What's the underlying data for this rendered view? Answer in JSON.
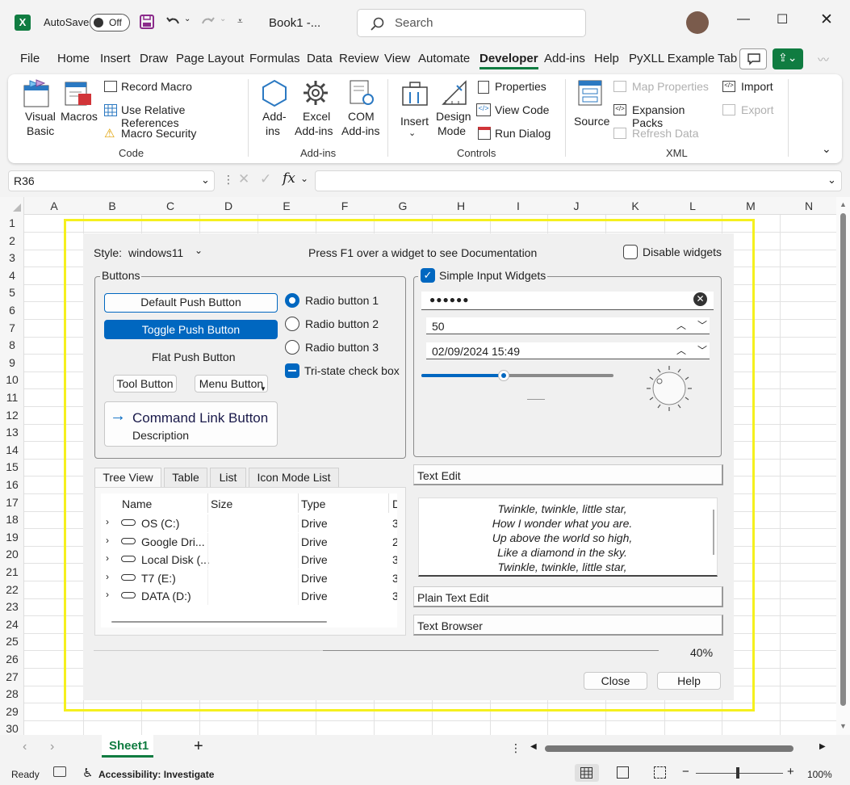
{
  "titlebar": {
    "autosave_label": "AutoSave",
    "autosave_state": "Off",
    "book_title": "Book1  -...",
    "search_placeholder": "Search"
  },
  "menu": [
    "File",
    "Home",
    "Insert",
    "Draw",
    "Page Layout",
    "Formulas",
    "Data",
    "Review",
    "View",
    "Automate",
    "Developer",
    "Add-ins",
    "Help",
    "PyXLL Example Tab"
  ],
  "menu_selected": "Developer",
  "ribbon": {
    "visual_basic": [
      "Visual",
      "Basic"
    ],
    "macros": "Macros",
    "record_macro": "Record Macro",
    "use_relative": "Use Relative References",
    "macro_security": "Macro Security",
    "code_group": "Code",
    "addins": [
      "Add-",
      "ins"
    ],
    "excel_addins": [
      "Excel",
      "Add-ins"
    ],
    "com_addins": [
      "COM",
      "Add-ins"
    ],
    "addins_group": "Add-ins",
    "insert": "Insert",
    "design_mode": [
      "Design",
      "Mode"
    ],
    "properties": "Properties",
    "view_code": "View Code",
    "run_dialog": "Run Dialog",
    "controls_group": "Controls",
    "source": "Source",
    "map_properties": "Map Properties",
    "expansion_packs": "Expansion Packs",
    "refresh_data": "Refresh Data",
    "import": "Import",
    "export": "Export",
    "xml_group": "XML"
  },
  "formula_bar": {
    "name_box": "R36",
    "fx": "fx",
    "content": ""
  },
  "columns": [
    "A",
    "B",
    "C",
    "D",
    "E",
    "F",
    "G",
    "H",
    "I",
    "J",
    "K",
    "L",
    "M",
    "N"
  ],
  "rows": [
    "1",
    "2",
    "3",
    "4",
    "5",
    "6",
    "7",
    "8",
    "9",
    "10",
    "11",
    "12",
    "13",
    "14",
    "15",
    "16",
    "17",
    "18",
    "19",
    "20",
    "21",
    "22",
    "23",
    "24",
    "25",
    "26",
    "27",
    "28",
    "29",
    "30"
  ],
  "dialog": {
    "style_label": "Style:",
    "style_value": "windows11",
    "f1_hint": "Press F1 over a widget to see Documentation",
    "disable_widgets": "Disable widgets",
    "buttons_group": "Buttons",
    "default_push": "Default Push Button",
    "toggle_push": "Toggle Push Button",
    "flat_push": "Flat Push Button",
    "tool_button": "Tool Button",
    "menu_button": "Menu Button",
    "command_link": "Command Link Button",
    "command_link_desc": "Description",
    "radio1": "Radio button 1",
    "radio2": "Radio button 2",
    "radio3": "Radio button 3",
    "tristate": "Tri-state check box",
    "simple_inputs": "Simple Input Widgets",
    "password": "●●●●●●",
    "spin_value": "50",
    "datetime_value": "02/09/2024 15:49",
    "slider_fraction": 0.43,
    "tabs": [
      "Tree View",
      "Table",
      "List",
      "Icon Mode List"
    ],
    "tree_headers": [
      "Name",
      "Size",
      "Type",
      "D"
    ],
    "tree_rows": [
      {
        "name": "OS (C:)",
        "type": "Drive",
        "d": "3"
      },
      {
        "name": "Google Dri...",
        "type": "Drive",
        "d": "2"
      },
      {
        "name": "Local Disk (...",
        "type": "Drive",
        "d": "3"
      },
      {
        "name": "T7 (E:)",
        "type": "Drive",
        "d": "3"
      },
      {
        "name": "DATA (D:)",
        "type": "Drive",
        "d": "3"
      }
    ],
    "text_edit": "Text Edit",
    "poem": [
      "Twinkle, twinkle, little star,",
      "How I wonder what you are.",
      "Up above the world so high,",
      "Like a diamond in the sky.",
      "Twinkle, twinkle, little star,"
    ],
    "plain_text_edit": "Plain Text Edit",
    "text_browser": "Text Browser",
    "progress_label": "40%",
    "progress_value": 0.4,
    "close": "Close",
    "help": "Help"
  },
  "sheet_tab": "Sheet1",
  "status": {
    "ready": "Ready",
    "accessibility": "Accessibility: Investigate",
    "zoom": "100%"
  },
  "colors": {
    "excel_green": "#107c41",
    "highlight_yellow": "#f5f01e",
    "qt_accent": "#0067c0"
  }
}
